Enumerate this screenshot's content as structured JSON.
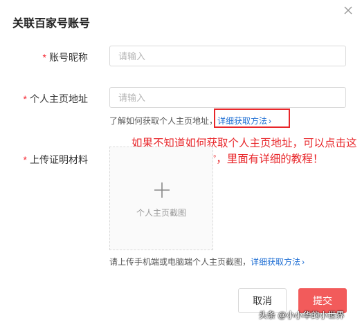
{
  "dialog": {
    "title": "关联百家号账号",
    "close_icon": "close-icon"
  },
  "form": {
    "nickname": {
      "required_mark": "*",
      "label": "账号昵称",
      "placeholder": "请输入",
      "value": ""
    },
    "homepage": {
      "required_mark": "*",
      "label": "个人主页地址",
      "placeholder": "请输入",
      "value": "",
      "hint_text": "了解如何获取个人主页地址，",
      "hint_link": "详细获取方法",
      "hint_chevron": "›"
    },
    "upload": {
      "required_mark": "*",
      "label": "上传证明材料",
      "box_text": "个人主页截图",
      "hint_text": "请上传手机端或电脑端个人主页截图，",
      "hint_link": "详细获取方法",
      "hint_chevron": "›"
    }
  },
  "annotation": {
    "text": "如果不知道如何获取个人主页地址，可以点击这里“详细获取方法”，里面有详细的教程！",
    "color": "#e8262a"
  },
  "buttons": {
    "cancel": "取消",
    "submit": "提交"
  },
  "colors": {
    "accent": "#f25b5b",
    "link": "#1f6fd4",
    "required": "#f5222d"
  },
  "watermark": "头条 @小小华的小世界"
}
